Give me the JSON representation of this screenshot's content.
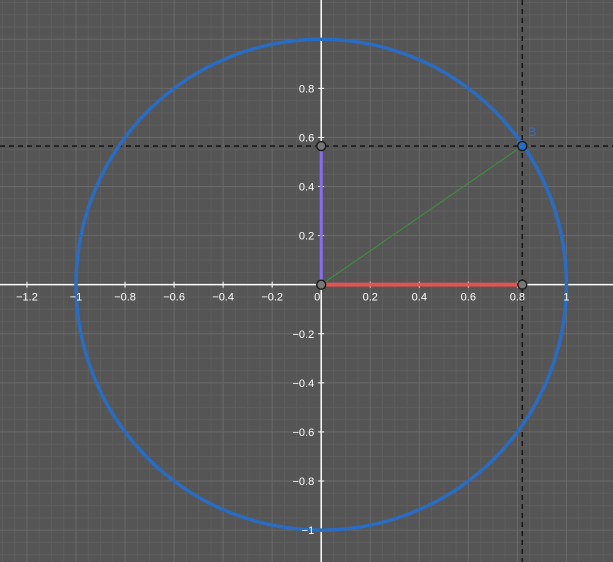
{
  "graph": {
    "x_tick_labels": [
      "−1.2",
      "−1",
      "−0.8",
      "−0.6",
      "−0.4",
      "−0.2",
      "0",
      "0.2",
      "0.4",
      "0.6",
      "0.8",
      "1"
    ],
    "x_tick_values": [
      -1.2,
      -1,
      -0.8,
      -0.6,
      -0.4,
      -0.2,
      0,
      0.2,
      0.4,
      0.6,
      0.8,
      1
    ],
    "y_tick_labels": [
      "0.8",
      "0.6",
      "0.4",
      "0.2",
      "−0.2",
      "−0.4",
      "−0.6",
      "−0.8",
      "−1"
    ],
    "y_tick_values": [
      0.8,
      0.6,
      0.4,
      0.2,
      -0.2,
      -0.4,
      -0.6,
      -0.8,
      -1
    ],
    "x_range": [
      -1.31,
      1.19
    ],
    "y_range": [
      -1.13,
      1.16
    ],
    "circle": {
      "center": [
        0,
        0
      ],
      "radius": 1,
      "color": "#2a6cc2"
    },
    "point_B": {
      "label": "B",
      "x": 0.82,
      "y": 0.565,
      "color": "#2a6cc2"
    },
    "origin_point": {
      "x": 0,
      "y": 0
    },
    "cos_segment": {
      "from": [
        0,
        0
      ],
      "to": [
        0.82,
        0
      ],
      "color": "#e05454"
    },
    "sin_segment": {
      "from": [
        0,
        0
      ],
      "to": [
        0,
        0.565
      ],
      "color": "#8a6cf0"
    },
    "radius_segment": {
      "from": [
        0,
        0
      ],
      "to": [
        0.82,
        0.565
      ],
      "color": "#3f8c3f"
    },
    "background": "#555555",
    "grid_minor_color": "#5e5e5e",
    "grid_major_color": "#6a6a6a",
    "axis_color": "#ffffff"
  }
}
